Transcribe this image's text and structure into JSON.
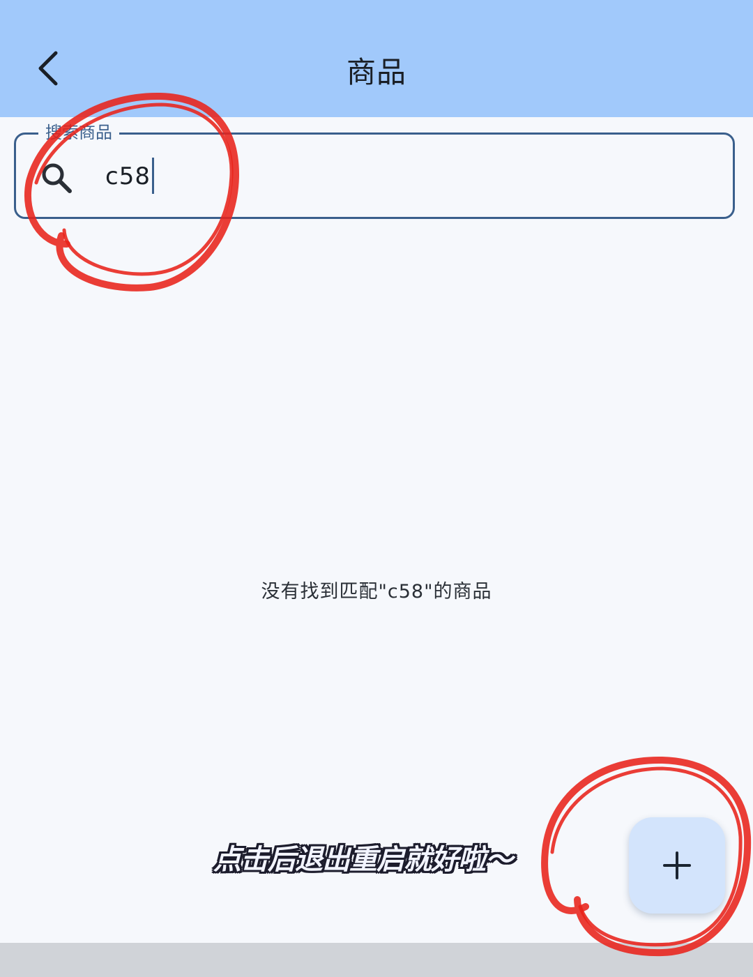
{
  "app_bar": {
    "title": "商品",
    "background_color": "#a1c9fb",
    "back_icon": "chevron-left-icon"
  },
  "search": {
    "label": "搜索商品",
    "value": "c58",
    "icon": "search-icon",
    "border_color": "#3a5f8c"
  },
  "main": {
    "empty_message": "没有找到匹配\"c58\"的商品"
  },
  "overlay": {
    "caption": "点击后退出重启就好啦～",
    "circle_color": "#e8221a"
  },
  "fab": {
    "icon": "plus-icon",
    "background_color": "#d3e4fc"
  }
}
